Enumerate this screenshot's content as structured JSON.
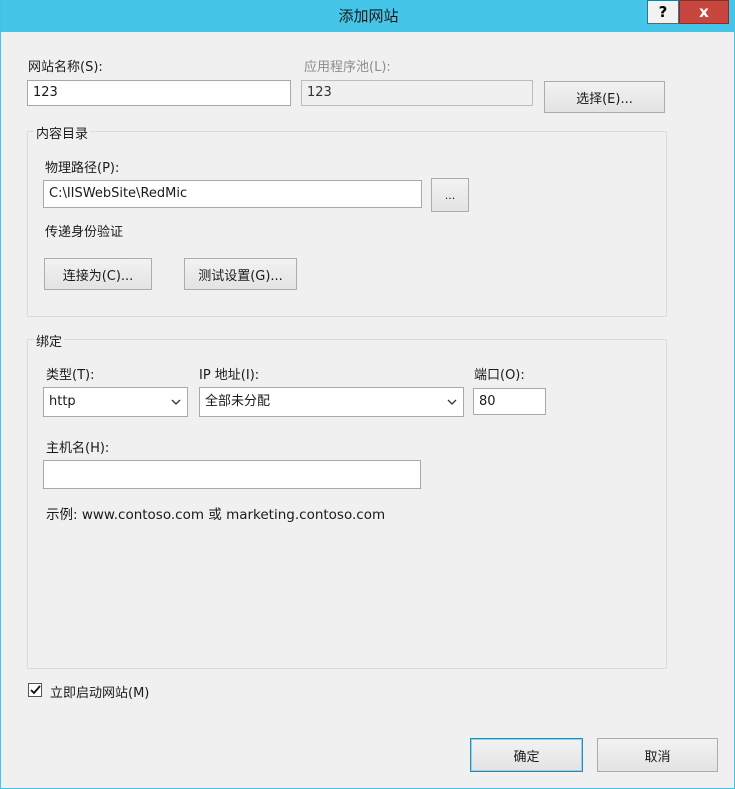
{
  "window": {
    "title": "添加网站",
    "help_label": "?",
    "close_label": "x"
  },
  "site": {
    "name_label": "网站名称(S):",
    "name_value": "123",
    "pool_label": "应用程序池(L):",
    "pool_value": "123",
    "select_button": "选择(E)..."
  },
  "content_dir": {
    "title": "内容目录",
    "path_label": "物理路径(P):",
    "path_value": "C:\\IISWebSite\\RedMic",
    "browse_button": "...",
    "auth_label": "传递身份验证",
    "connect_button": "连接为(C)...",
    "test_button": "测试设置(G)..."
  },
  "binding": {
    "title": "绑定",
    "type_label": "类型(T):",
    "type_value": "http",
    "ip_label": "IP 地址(I):",
    "ip_value": "全部未分配",
    "port_label": "端口(O):",
    "port_value": "80",
    "host_label": "主机名(H):",
    "host_value": "",
    "example": "示例: www.contoso.com 或 marketing.contoso.com"
  },
  "start_site": {
    "label": "立即启动网站(M)",
    "checked": true
  },
  "footer": {
    "ok_button": "确定",
    "cancel_button": "取消"
  },
  "colors": {
    "titlebar": "#45c5e8",
    "close": "#c9463f",
    "window_bg": "#f0f0f0"
  }
}
